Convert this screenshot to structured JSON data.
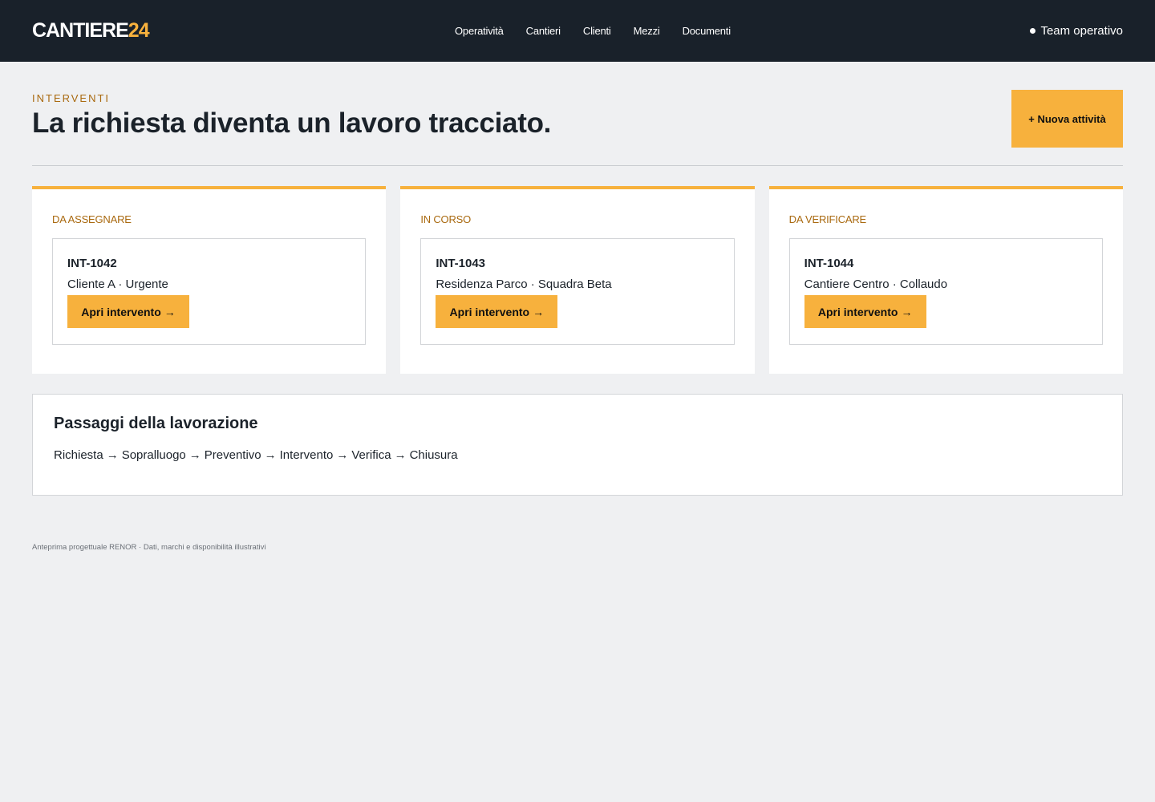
{
  "header": {
    "logo_main": "CANTIERE",
    "logo_accent": "24",
    "nav": [
      "Operatività",
      "Cantieri",
      "Clienti",
      "Mezzi",
      "Documenti"
    ],
    "team_label": "Team operativo"
  },
  "page": {
    "eyebrow": "INTERVENTI",
    "title": "La richiesta diventa un lavoro tracciato.",
    "new_activity_label": "+ Nuova attività"
  },
  "columns": [
    {
      "title": "DA ASSEGNARE",
      "card": {
        "id": "INT-1042",
        "meta": "Cliente A · Urgente",
        "button": "Apri intervento",
        "button_icon": "→"
      }
    },
    {
      "title": "IN CORSO",
      "card": {
        "id": "INT-1043",
        "meta": "Residenza Parco · Squadra Beta",
        "button": "Apri intervento",
        "button_icon": "→"
      }
    },
    {
      "title": "DA VERIFICARE",
      "card": {
        "id": "INT-1044",
        "meta": "Cantiere Centro · Collaudo",
        "button": "Apri intervento",
        "button_icon": "→"
      }
    }
  ],
  "steps": {
    "title": "Passaggi della lavorazione",
    "items": [
      "Richiesta",
      "Sopralluogo",
      "Preventivo",
      "Intervento",
      "Verifica",
      "Chiusura"
    ],
    "separator": "→"
  },
  "footer": {
    "note": "Anteprima progettuale RENOR · Dati, marchi e disponibilità illustrativi"
  },
  "colors": {
    "accent": "#f7b13d",
    "header_bg": "#19212a",
    "eyebrow": "#a9690f",
    "page_bg": "#eff0f2"
  }
}
